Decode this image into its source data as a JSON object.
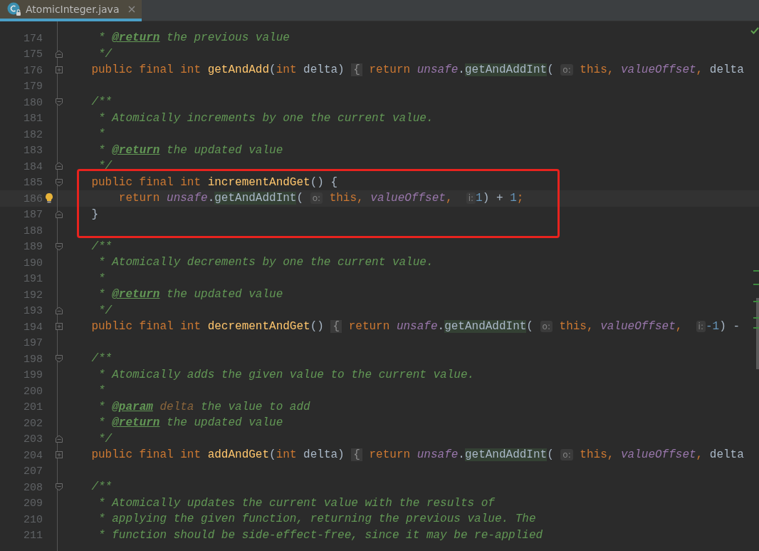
{
  "tabs": [
    {
      "label": "AtomicInteger.java",
      "selected": true
    }
  ],
  "lines": [
    {
      "number": "174",
      "current": false,
      "boxed": false,
      "tokens": [
        {
          "kind": "doc",
          "text": "     * "
        },
        {
          "kind": "tag",
          "text": "@return"
        },
        {
          "kind": "doc",
          "text": " the previous value"
        }
      ]
    },
    {
      "number": "175",
      "current": false,
      "boxed": false,
      "fold_marker": {
        "kind": "end"
      },
      "tokens": [
        {
          "kind": "doc",
          "text": "     */"
        }
      ]
    },
    {
      "number": "176",
      "current": false,
      "boxed": false,
      "fold_marker": {
        "kind": "collapsed"
      },
      "tokens": [
        {
          "kind": "kw",
          "text": "    public final int "
        },
        {
          "kind": "decl",
          "text": "getAndAdd"
        },
        {
          "kind": "plain",
          "text": "("
        },
        {
          "kind": "kw",
          "text": "int"
        },
        {
          "kind": "plain",
          "text": " delta) "
        },
        {
          "kind": "fold",
          "text": "{"
        },
        {
          "kind": "kw",
          "text": " return "
        },
        {
          "kind": "field",
          "text": "unsafe"
        },
        {
          "kind": "plain",
          "text": "."
        },
        {
          "kind": "call",
          "text": "getAndAddInt"
        },
        {
          "kind": "plain",
          "text": "( "
        },
        {
          "kind": "hint",
          "text": "o:"
        },
        {
          "kind": "kw",
          "text": " this, "
        },
        {
          "kind": "field",
          "text": "valueOffset"
        },
        {
          "kind": "kw",
          "text": ", "
        },
        {
          "kind": "plain",
          "text": "delta"
        }
      ]
    },
    {
      "number": "179",
      "current": false,
      "boxed": false
    },
    {
      "number": "180",
      "current": false,
      "boxed": false,
      "fold_marker": {
        "kind": "start"
      },
      "tokens": [
        {
          "kind": "doc",
          "text": "    /**"
        }
      ]
    },
    {
      "number": "181",
      "current": false,
      "boxed": false,
      "tokens": [
        {
          "kind": "doc",
          "text": "     * Atomically increments by one the current value."
        }
      ]
    },
    {
      "number": "182",
      "current": false,
      "boxed": false,
      "tokens": [
        {
          "kind": "doc",
          "text": "     *"
        }
      ]
    },
    {
      "number": "183",
      "current": false,
      "boxed": false,
      "tokens": [
        {
          "kind": "doc",
          "text": "     * "
        },
        {
          "kind": "tag",
          "text": "@return"
        },
        {
          "kind": "doc",
          "text": " the updated value"
        }
      ]
    },
    {
      "number": "184",
      "current": false,
      "boxed": false,
      "fold_marker": {
        "kind": "end"
      },
      "tokens": [
        {
          "kind": "doc",
          "text": "     */"
        }
      ]
    },
    {
      "number": "185",
      "current": false,
      "boxed": true,
      "fold_marker": {
        "kind": "start"
      },
      "tokens": [
        {
          "kind": "kw",
          "text": "    public final int "
        },
        {
          "kind": "decl",
          "text": "incrementAndGet"
        },
        {
          "kind": "plain",
          "text": "() {"
        }
      ]
    },
    {
      "number": "186",
      "current": true,
      "boxed": true,
      "gutter_icon": {
        "kind": "bulb"
      },
      "tokens": [
        {
          "kind": "kw",
          "text": "        return "
        },
        {
          "kind": "field",
          "text": "unsafe"
        },
        {
          "kind": "plain",
          "text": "."
        },
        {
          "kind": "call",
          "text": "getAndAddInt"
        },
        {
          "kind": "plain",
          "text": "( "
        },
        {
          "kind": "hint",
          "text": "o:"
        },
        {
          "kind": "kw",
          "text": " this, "
        },
        {
          "kind": "field",
          "text": "valueOffset"
        },
        {
          "kind": "kw",
          "text": ",  "
        },
        {
          "kind": "hint",
          "text": "i:"
        },
        {
          "kind": "num",
          "text": "1"
        },
        {
          "kind": "plain",
          "text": ") + "
        },
        {
          "kind": "num",
          "text": "1"
        },
        {
          "kind": "kw",
          "text": ";"
        }
      ]
    },
    {
      "number": "187",
      "current": false,
      "boxed": true,
      "fold_marker": {
        "kind": "end"
      },
      "tokens": [
        {
          "kind": "plain",
          "text": "    }"
        }
      ]
    },
    {
      "number": "188",
      "current": false,
      "boxed": true
    },
    {
      "number": "189",
      "current": false,
      "boxed": false,
      "fold_marker": {
        "kind": "start"
      },
      "tokens": [
        {
          "kind": "doc",
          "text": "    /**"
        }
      ]
    },
    {
      "number": "190",
      "current": false,
      "boxed": false,
      "tokens": [
        {
          "kind": "doc",
          "text": "     * Atomically decrements by one the current value."
        }
      ]
    },
    {
      "number": "191",
      "current": false,
      "boxed": false,
      "tokens": [
        {
          "kind": "doc",
          "text": "     *"
        }
      ]
    },
    {
      "number": "192",
      "current": false,
      "boxed": false,
      "tokens": [
        {
          "kind": "doc",
          "text": "     * "
        },
        {
          "kind": "tag",
          "text": "@return"
        },
        {
          "kind": "doc",
          "text": " the updated value"
        }
      ]
    },
    {
      "number": "193",
      "current": false,
      "boxed": false,
      "fold_marker": {
        "kind": "end"
      },
      "tokens": [
        {
          "kind": "doc",
          "text": "     */"
        }
      ]
    },
    {
      "number": "194",
      "current": false,
      "boxed": false,
      "fold_marker": {
        "kind": "collapsed"
      },
      "tokens": [
        {
          "kind": "kw",
          "text": "    public final int "
        },
        {
          "kind": "decl",
          "text": "decrementAndGet"
        },
        {
          "kind": "plain",
          "text": "() "
        },
        {
          "kind": "fold",
          "text": "{"
        },
        {
          "kind": "kw",
          "text": " return "
        },
        {
          "kind": "field",
          "text": "unsafe"
        },
        {
          "kind": "plain",
          "text": "."
        },
        {
          "kind": "call",
          "text": "getAndAddInt"
        },
        {
          "kind": "plain",
          "text": "( "
        },
        {
          "kind": "hint",
          "text": "o:"
        },
        {
          "kind": "kw",
          "text": " this, "
        },
        {
          "kind": "field",
          "text": "valueOffset"
        },
        {
          "kind": "kw",
          "text": ",  "
        },
        {
          "kind": "hint",
          "text": "i:"
        },
        {
          "kind": "num",
          "text": "-1"
        },
        {
          "kind": "plain",
          "text": ") -"
        }
      ]
    },
    {
      "number": "197",
      "current": false,
      "boxed": false
    },
    {
      "number": "198",
      "current": false,
      "boxed": false,
      "fold_marker": {
        "kind": "start"
      },
      "tokens": [
        {
          "kind": "doc",
          "text": "    /**"
        }
      ]
    },
    {
      "number": "199",
      "current": false,
      "boxed": false,
      "tokens": [
        {
          "kind": "doc",
          "text": "     * Atomically adds the given value to the current value."
        }
      ]
    },
    {
      "number": "200",
      "current": false,
      "boxed": false,
      "tokens": [
        {
          "kind": "doc",
          "text": "     *"
        }
      ]
    },
    {
      "number": "201",
      "current": false,
      "boxed": false,
      "tokens": [
        {
          "kind": "doc",
          "text": "     * "
        },
        {
          "kind": "tag",
          "text": "@param"
        },
        {
          "kind": "pname",
          "text": " delta"
        },
        {
          "kind": "doc",
          "text": " the value to add"
        }
      ]
    },
    {
      "number": "202",
      "current": false,
      "boxed": false,
      "tokens": [
        {
          "kind": "doc",
          "text": "     * "
        },
        {
          "kind": "tag",
          "text": "@return"
        },
        {
          "kind": "doc",
          "text": " the updated value"
        }
      ]
    },
    {
      "number": "203",
      "current": false,
      "boxed": false,
      "fold_marker": {
        "kind": "end"
      },
      "tokens": [
        {
          "kind": "doc",
          "text": "     */"
        }
      ]
    },
    {
      "number": "204",
      "current": false,
      "boxed": false,
      "fold_marker": {
        "kind": "collapsed"
      },
      "tokens": [
        {
          "kind": "kw",
          "text": "    public final int "
        },
        {
          "kind": "decl",
          "text": "addAndGet"
        },
        {
          "kind": "plain",
          "text": "("
        },
        {
          "kind": "kw",
          "text": "int"
        },
        {
          "kind": "plain",
          "text": " delta) "
        },
        {
          "kind": "fold",
          "text": "{"
        },
        {
          "kind": "kw",
          "text": " return "
        },
        {
          "kind": "field",
          "text": "unsafe"
        },
        {
          "kind": "plain",
          "text": "."
        },
        {
          "kind": "call",
          "text": "getAndAddInt"
        },
        {
          "kind": "plain",
          "text": "( "
        },
        {
          "kind": "hint",
          "text": "o:"
        },
        {
          "kind": "kw",
          "text": " this, "
        },
        {
          "kind": "field",
          "text": "valueOffset"
        },
        {
          "kind": "kw",
          "text": ", "
        },
        {
          "kind": "plain",
          "text": "delta"
        }
      ]
    },
    {
      "number": "207",
      "current": false,
      "boxed": false
    },
    {
      "number": "208",
      "current": false,
      "boxed": false,
      "fold_marker": {
        "kind": "start"
      },
      "tokens": [
        {
          "kind": "doc",
          "text": "    /**"
        }
      ]
    },
    {
      "number": "209",
      "current": false,
      "boxed": false,
      "tokens": [
        {
          "kind": "doc",
          "text": "     * Atomically updates the current value with the results of"
        }
      ]
    },
    {
      "number": "210",
      "current": false,
      "boxed": false,
      "tokens": [
        {
          "kind": "doc",
          "text": "     * applying the given function, returning the previous value. The"
        }
      ]
    },
    {
      "number": "211",
      "current": false,
      "boxed": false,
      "tokens": [
        {
          "kind": "doc",
          "text": "     * function should be side-effect-free, since it may be re-applied"
        }
      ]
    }
  ]
}
